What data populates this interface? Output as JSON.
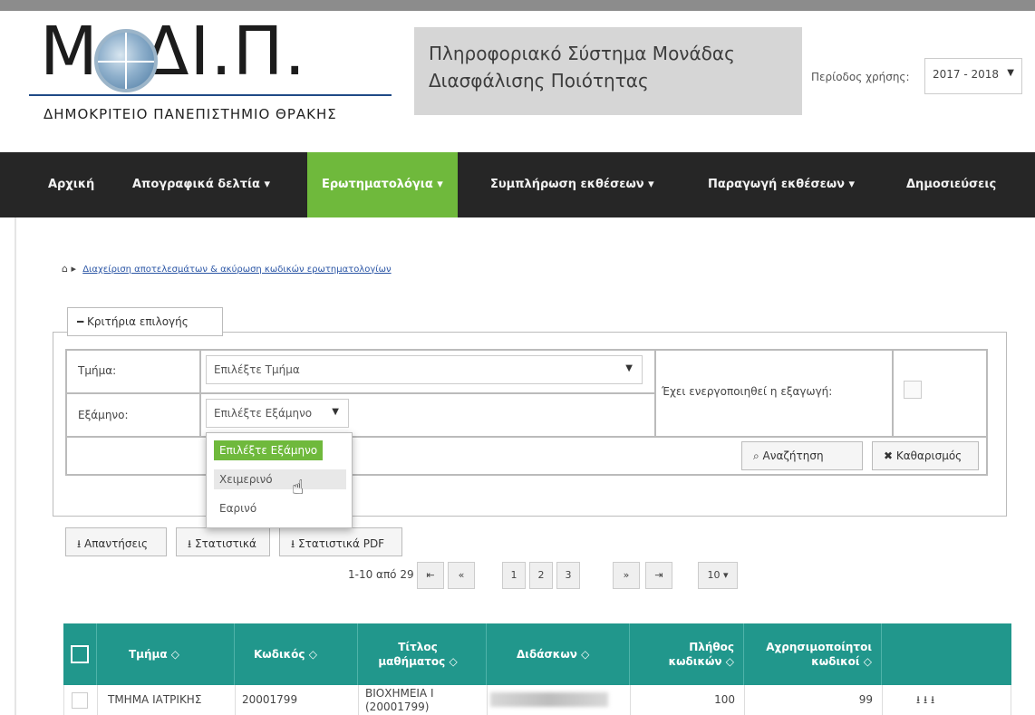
{
  "header": {
    "logo_text": "Μ  .ΔΙ.Π.",
    "logo_subtitle": "ΔΗΜΟΚΡΙΤΕΙΟ ΠΑΝΕΠΙΣΤΗΜΙΟ ΘΡΑΚΗΣ",
    "system_line1": "Πληροφοριακό Σύστημα Μονάδας",
    "system_line2": "Διασφάλισης Ποιότητας",
    "period_label": "Περίοδος χρήσης:",
    "period_value": "2017 - 2018"
  },
  "nav": {
    "items": [
      {
        "label": "Αρχική"
      },
      {
        "label": "Απογραφικά δελτία ▾"
      },
      {
        "label": "Ερωτηματολόγια ▾"
      },
      {
        "label": "Συμπλήρωση εκθέσεων ▾"
      },
      {
        "label": "Παραγωγή εκθέσεων ▾"
      },
      {
        "label": "Δημοσιεύσεις"
      }
    ]
  },
  "breadcrumb": {
    "home_icon": "home-icon",
    "link": "Διαχείριση αποτελεσμάτων & ακύρωση κωδικών ερωτηματολογίων"
  },
  "filters": {
    "legend": "Κριτήρια επιλογής",
    "department_label": "Τμήμα:",
    "department_value": "Επιλέξτε Τμήμα",
    "semester_label": "Εξάμηνο:",
    "semester_value": "Επιλέξτε Εξάμηνο",
    "export_label": "Έχει ενεργοποιηθεί η εξαγωγή:",
    "search_button": "Αναζήτηση",
    "clear_button": "Καθαρισμός",
    "semester_options": [
      "Επιλέξτε Εξάμηνο",
      "Χειμερινό",
      "Εαρινό"
    ]
  },
  "exports": {
    "answers": "Απαντήσεις",
    "statistics": "Στατιστικά",
    "statistics_pdf": "Στατιστικά PDF"
  },
  "pagination": {
    "summary": "1-10 από 29",
    "first": "⇤",
    "prev": "«",
    "pages": [
      "1",
      "2",
      "3"
    ],
    "next": "»",
    "last": "⇥",
    "page_size": "10 ▾"
  },
  "table": {
    "headers": {
      "department": "Τμήμα ◇",
      "code": "Κωδικός ◇",
      "title": "Τίτλος μαθήματος ◇",
      "teacher": "Διδάσκων ◇",
      "codes_count": "Πλήθος κωδικών ◇",
      "unused_codes": "Αχρησιμοποίητοι κωδικοί ◇"
    },
    "rows": [
      {
        "department": "ΤΜΗΜΑ ΙΑΤΡΙΚΗΣ",
        "code": "20001799",
        "title_line1": "ΒΙΟΧΗΜΕΙΑ Ι",
        "title_line2": "(20001799)",
        "codes_count": "100",
        "unused_codes": "99",
        "actions": "⭳ ⭳ ⭳"
      }
    ]
  },
  "colors": {
    "accent_green": "#6fb93c",
    "navbar_dark": "#262626",
    "table_teal": "#21978c"
  }
}
